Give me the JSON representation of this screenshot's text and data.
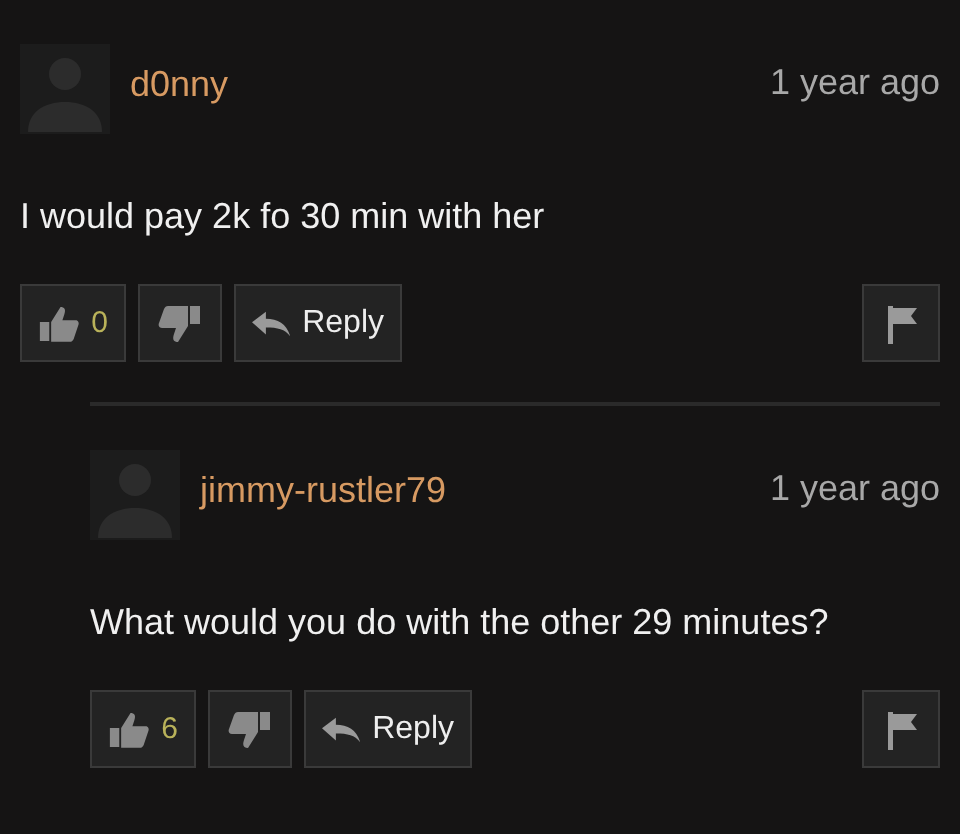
{
  "comments": [
    {
      "author": "d0nny",
      "time": "1 year ago",
      "text": "I would pay 2k fo 30 min with her",
      "likes": "0",
      "reply_label": "Reply",
      "children": [
        {
          "author": "jimmy-rustler79",
          "time": "1 year ago",
          "text": "What would you do with the other 29 minutes?",
          "likes": "6",
          "reply_label": "Reply"
        }
      ]
    }
  ]
}
